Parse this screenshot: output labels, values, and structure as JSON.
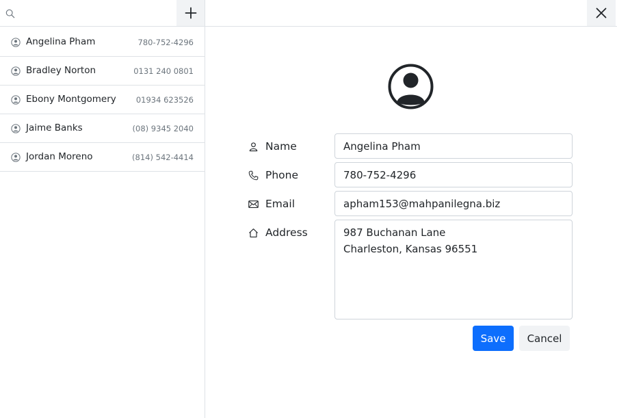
{
  "search": {
    "placeholder": "",
    "value": ""
  },
  "toolbar": {
    "add_icon": "plus-icon",
    "close_icon": "close-icon"
  },
  "contacts": [
    {
      "name": "Angelina Pham",
      "phone": "780-752-4296"
    },
    {
      "name": "Bradley Norton",
      "phone": "0131 240 0801"
    },
    {
      "name": "Ebony Montgomery",
      "phone": "01934 623526"
    },
    {
      "name": "Jaime Banks",
      "phone": "(08) 9345 2040"
    },
    {
      "name": "Jordan Moreno",
      "phone": "(814) 542-4414"
    }
  ],
  "form": {
    "avatar_icon": "person-circle-icon",
    "name_label": "Name",
    "name_value": "Angelina Pham",
    "phone_label": "Phone",
    "phone_value": "780-752-4296",
    "email_label": "Email",
    "email_value": "apham153@mahpanilegna.biz",
    "address_label": "Address",
    "address_value": "987 Buchanan Lane\nCharleston, Kansas 96551",
    "save_label": "Save",
    "cancel_label": "Cancel"
  },
  "colors": {
    "primary": "#0d6efd",
    "muted_text": "#6c757d",
    "border": "#dee2e6",
    "button_bg": "#f1f3f5"
  }
}
